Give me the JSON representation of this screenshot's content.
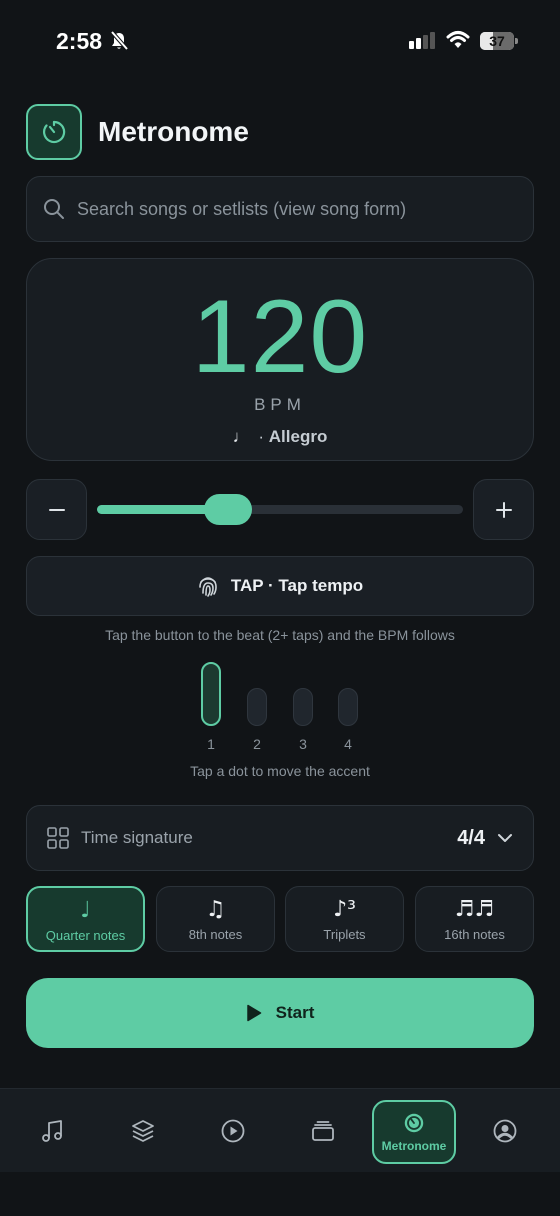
{
  "status_bar": {
    "time": "2:58",
    "battery": "37",
    "battery_level": 0.37
  },
  "header": {
    "title": "Metronome",
    "logo_icon": "metronome-dial-icon"
  },
  "search": {
    "placeholder": "Search songs or setlists (view song form)"
  },
  "bpm": {
    "value": "120",
    "unit": "BPM",
    "note_glyph": "♩",
    "tempo_name": "Allegro"
  },
  "slider": {
    "min": 20,
    "max": 300,
    "value": 120
  },
  "controls": {
    "decrease_icon": "minus-icon",
    "increase_icon": "plus-icon"
  },
  "tap": {
    "label": "TAP · Tap tempo",
    "hint": "Tap the button to the beat (2+ taps) and the BPM follows"
  },
  "beats": {
    "items": [
      {
        "label": "1",
        "accent": true
      },
      {
        "label": "2",
        "accent": false
      },
      {
        "label": "3",
        "accent": false
      },
      {
        "label": "4",
        "accent": false
      }
    ],
    "hint": "Tap a dot to move the accent"
  },
  "time_signature": {
    "label": "Time signature",
    "value": "4/4"
  },
  "subdivisions": [
    {
      "glyph": "♩",
      "label": "Quarter notes",
      "active": true
    },
    {
      "glyph": "♫",
      "label": "8th notes",
      "active": false
    },
    {
      "glyph": "♪³",
      "label": "Triplets",
      "active": false
    },
    {
      "glyph": "♬♬",
      "label": "16th notes",
      "active": false
    }
  ],
  "start": {
    "label": "Start"
  },
  "tabs": [
    {
      "icon": "music-note-icon",
      "label": ""
    },
    {
      "icon": "layers-icon",
      "label": ""
    },
    {
      "icon": "play-circle-icon",
      "label": ""
    },
    {
      "icon": "stack-icon",
      "label": ""
    },
    {
      "icon": "metronome-dial-icon",
      "label": "Metronome",
      "active": true
    },
    {
      "icon": "profile-icon",
      "label": ""
    }
  ],
  "colors": {
    "accent": "#5ecca4",
    "background": "#111417",
    "surface": "#181d22"
  }
}
